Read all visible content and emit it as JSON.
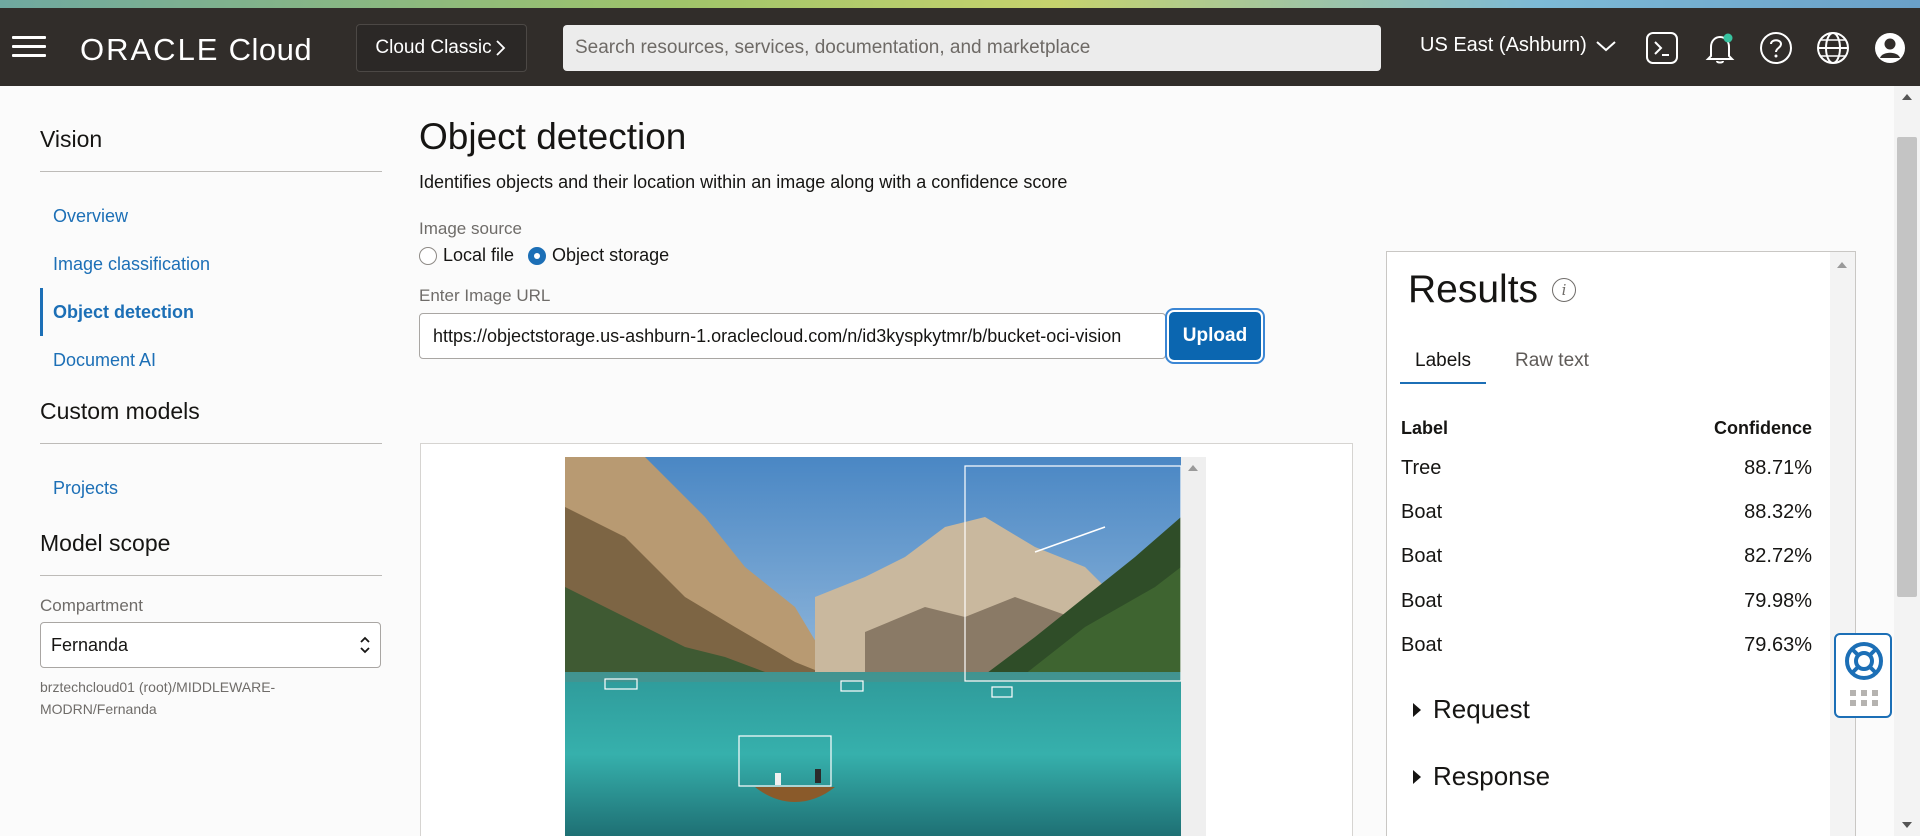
{
  "header": {
    "logo_oracle": "ORACLE",
    "logo_cloud": "Cloud",
    "classic_label": "Cloud Classic",
    "search_placeholder": "Search resources, services, documentation, and marketplace",
    "region": "US East (Ashburn)"
  },
  "sidebar": {
    "section_title": "Vision",
    "items": [
      {
        "label": "Overview"
      },
      {
        "label": "Image classification"
      },
      {
        "label": "Object detection"
      },
      {
        "label": "Document AI"
      }
    ],
    "custom_models_title": "Custom models",
    "projects_label": "Projects",
    "model_scope_title": "Model scope",
    "compartment_label": "Compartment",
    "compartment_value": "Fernanda",
    "compartment_path": "brztechcloud01 (root)/MIDDLEWARE-MODRN/Fernanda"
  },
  "main": {
    "title": "Object detection",
    "description": "Identifies objects and their location within an image along with a confidence score",
    "image_source_label": "Image source",
    "radio_local": "Local file",
    "radio_object": "Object storage",
    "selected_source": "Object storage",
    "url_label": "Enter Image URL",
    "url_value": "https://objectstorage.us-ashburn-1.oraclecloud.com/n/id3kyspkytmr/b/bucket-oci-vision",
    "upload_label": "Upload"
  },
  "results": {
    "title": "Results",
    "tabs": [
      "Labels",
      "Raw text"
    ],
    "active_tab": "Labels",
    "col_label": "Label",
    "col_confidence": "Confidence",
    "rows": [
      {
        "label": "Tree",
        "confidence": "88.71%"
      },
      {
        "label": "Boat",
        "confidence": "88.32%"
      },
      {
        "label": "Boat",
        "confidence": "82.72%"
      },
      {
        "label": "Boat",
        "confidence": "79.98%"
      },
      {
        "label": "Boat",
        "confidence": "79.63%"
      }
    ],
    "request_label": "Request",
    "response_label": "Response"
  },
  "colors": {
    "header_bg": "#312d2a",
    "link_blue": "#1c6fb6",
    "upload_blue": "#0b66b0"
  },
  "icons": [
    "hamburger-icon",
    "chevron-right-icon",
    "chevron-down-icon",
    "cloud-shell-icon",
    "bell-icon",
    "help-icon",
    "globe-icon",
    "user-icon",
    "info-icon",
    "lifebuoy-icon"
  ]
}
